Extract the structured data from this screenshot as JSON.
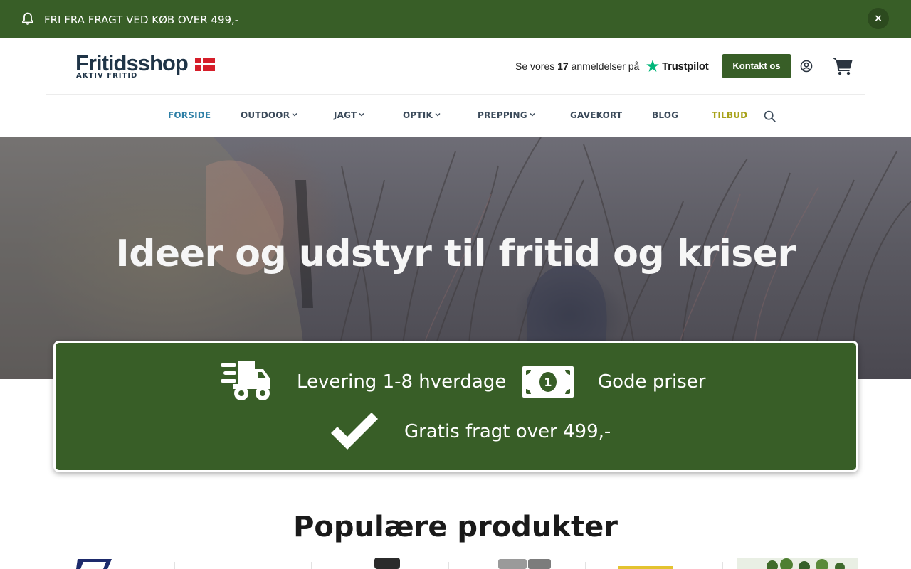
{
  "announcement": {
    "text": "FRI FRA FRAGT VED KØB OVER 499,-",
    "close_label": "×",
    "icon": "bell-icon"
  },
  "header": {
    "logo_name": "Fritidsshop",
    "logo_tagline": "AKTIV FRITID",
    "trust_prefix": "Se vores",
    "trust_count": "17",
    "trust_suffix": "anmeldelser på",
    "trust_brand": "Trustpilot",
    "contact_label": "Kontakt os",
    "icons": [
      "user-icon",
      "cart-icon"
    ]
  },
  "nav": {
    "items": [
      {
        "label": "FORSIDE"
      },
      {
        "label": "OUTDOOR"
      },
      {
        "label": "JAGT"
      },
      {
        "label": "OPTIK"
      },
      {
        "label": "PREPPING"
      },
      {
        "label": "GAVEKORT"
      },
      {
        "label": "BLOG"
      },
      {
        "label": "TILBUD"
      }
    ]
  },
  "hero": {
    "headline": "Ideer og udstyr til fritid og kriser"
  },
  "features": {
    "items": [
      {
        "label": "Levering 1-8 hverdage",
        "icon": "truck-icon"
      },
      {
        "label": "Gode priser",
        "icon": "money-icon"
      },
      {
        "label": "Gratis fragt over 499,-",
        "icon": "check-icon"
      }
    ]
  },
  "popular": {
    "title": "Populære produkter"
  },
  "colors": {
    "brand_green": "#385e27",
    "nav_active": "#2d7fa6",
    "nav_sale": "#a8a21a",
    "logo_navy": "#1f3447",
    "flag_red": "#d61e2a"
  }
}
